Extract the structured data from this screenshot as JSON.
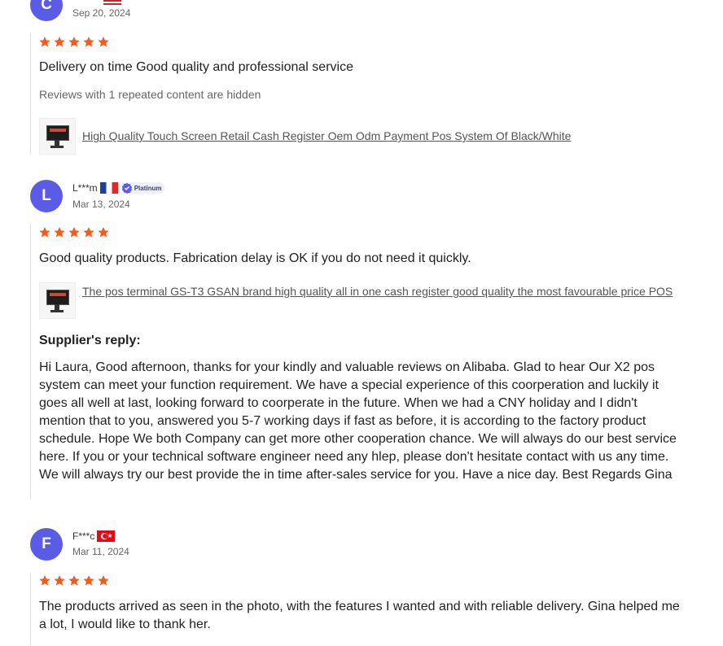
{
  "colors": {
    "avatar": "#5b5ce6",
    "star": "#f55b1b",
    "link": "#555555"
  },
  "reviews": [
    {
      "initial": "C",
      "flag": "us-flag-icon",
      "date": "Sep 20, 2024",
      "rating": 5,
      "text": "Delivery on time Good quality and professional service",
      "hidden_note": "Reviews with 1 repeated content are hidden",
      "product": "High Quality Touch Screen Retail Cash Register Oem Odm Payment Pos System Of Black/White"
    },
    {
      "initial": "L",
      "username": "L***m",
      "flag": "fr-flag-icon",
      "badge": "Platinum",
      "date": "Mar 13, 2024",
      "rating": 5,
      "text": "Good quality products. Fabrication delay is OK if you do not need it quickly.",
      "product": "The pos terminal GS-T3 GSAN brand high quality all in one cash register good quality the most favourable price POS",
      "reply_title": "Supplier's reply:",
      "reply_text": "Hi Laura, Good afternoon, thanks for your kindly and valuable reviews on Alibaba. Glad to hear Our X2 pos system can meet your function requirement. We have a special experience of this coorperation and luckily it goes all well at last, looking forward to coorperate in the future. When we had a CNY holiday and I didn't mention that to you, answered you 5-7 working days if fast as before, it is according to the factory product schedule. Hope We both Company can get more other cooperation chance. We will always do our best service here. If you or your technical software engineer need any hlep, please don't hesitate contact with us any time. We will always try our best provide the in time after-sales service for you. Have a nice day. Best Regards Gina"
    },
    {
      "initial": "F",
      "username": "F***c",
      "flag": "tr-flag-icon",
      "date": "Mar 11, 2024",
      "rating": 5,
      "text": "The products arrived as seen in the photo, with the features I wanted and with reliable delivery. Gina helped me a lot, I would like to thank her."
    }
  ]
}
